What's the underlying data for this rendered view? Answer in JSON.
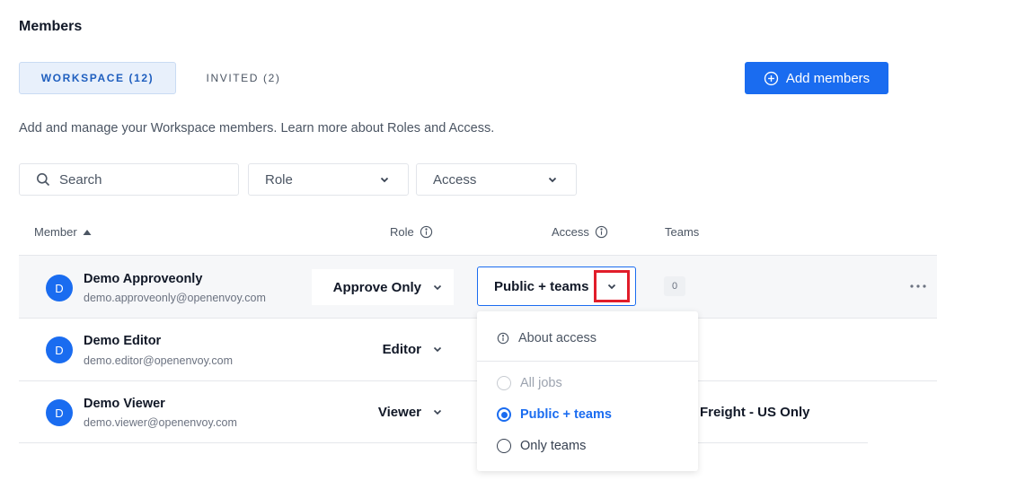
{
  "header": {
    "title": "Members"
  },
  "tabs": [
    {
      "label": "WORKSPACE (12)",
      "active": true
    },
    {
      "label": "INVITED (2)",
      "active": false
    }
  ],
  "actions": {
    "add_members_label": "Add members"
  },
  "description": "Add and manage your Workspace members. Learn more about Roles and Access.",
  "filters": {
    "search_placeholder": "Search",
    "role_label": "Role",
    "access_label": "Access"
  },
  "table": {
    "columns": [
      "Member",
      "Role",
      "Access",
      "Teams"
    ],
    "rows": [
      {
        "initial": "D",
        "name": "Demo Approveonly",
        "email": "demo.approveonly@openenvoy.com",
        "role": "Approve Only",
        "access": "Public + teams",
        "teams_count": "0"
      },
      {
        "initial": "D",
        "name": "Demo Editor",
        "email": "demo.editor@openenvoy.com",
        "role": "Editor"
      },
      {
        "initial": "D",
        "name": "Demo Viewer",
        "email": "demo.viewer@openenvoy.com",
        "role": "Viewer",
        "teams": "Freight - US Only"
      }
    ]
  },
  "access_dropdown": {
    "about_label": "About access",
    "options": [
      {
        "label": "All jobs",
        "state": "disabled"
      },
      {
        "label": "Public + teams",
        "state": "selected"
      },
      {
        "label": "Only teams",
        "state": "unselected"
      }
    ]
  },
  "colors": {
    "accent": "#1a6cf0",
    "highlight_border": "#e11d2a"
  }
}
